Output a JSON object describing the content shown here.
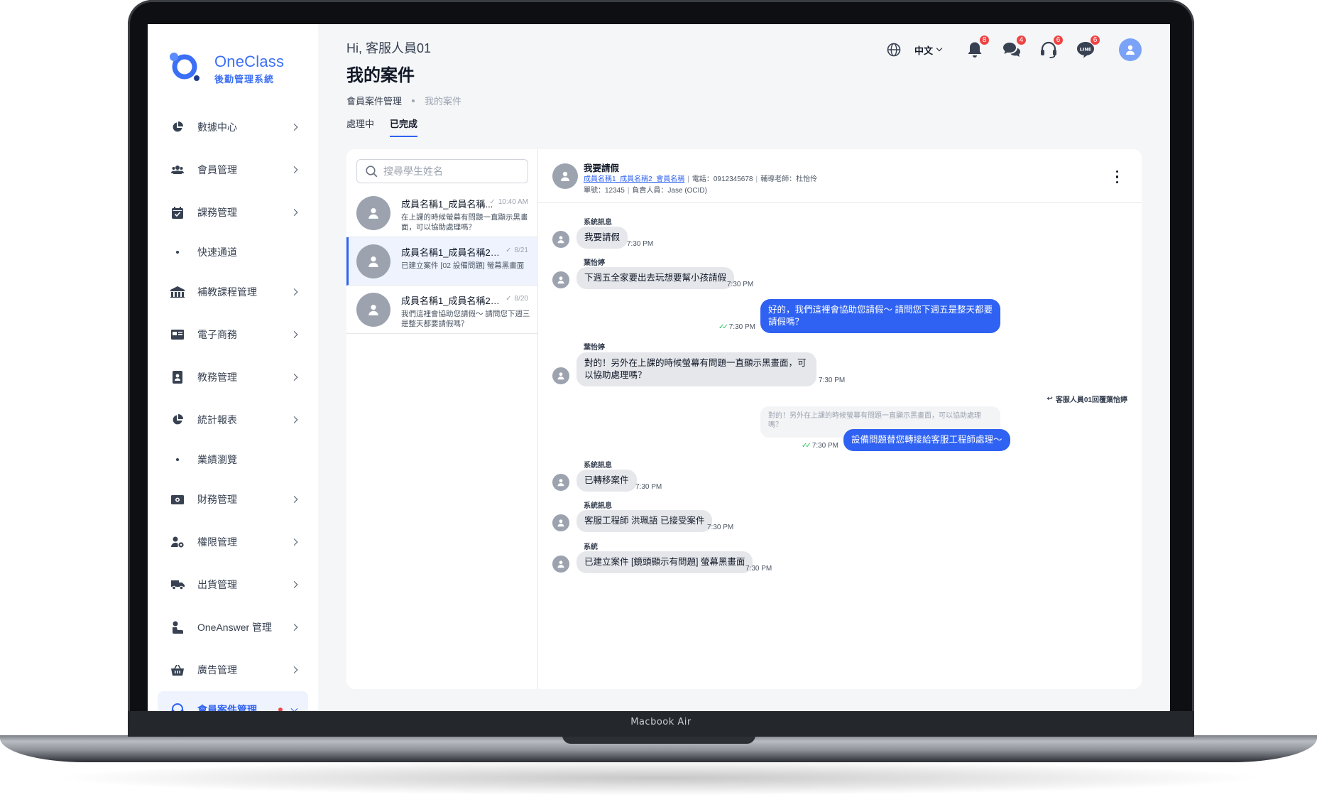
{
  "device": {
    "label": "Macbook Air"
  },
  "brand": {
    "name": "OneClass",
    "subtitle": "後勤管理系統",
    "color": "#3b6ff5"
  },
  "header": {
    "greeting": "Hi, 客服人員01",
    "title": "我的案件",
    "breadcrumb": [
      "會員案件管理",
      "我的案件"
    ],
    "tabs": [
      "處理中",
      "已完成"
    ],
    "active_tab": "已完成",
    "language": "中文",
    "badges": {
      "notifications": "8",
      "messages": "4",
      "support": "6",
      "line": "6"
    }
  },
  "sidebar": {
    "items": [
      {
        "label": "數據中心",
        "icon": "pie-chart-icon"
      },
      {
        "label": "會員管理",
        "icon": "users-icon"
      },
      {
        "label": "課務管理",
        "icon": "calendar-check-icon"
      },
      {
        "label": "快速通道",
        "icon": "dot"
      },
      {
        "label": "補教課程管理",
        "icon": "building-icon"
      },
      {
        "label": "電子商務",
        "icon": "ecommerce-icon"
      },
      {
        "label": "教務管理",
        "icon": "badge-icon"
      },
      {
        "label": "統計報表",
        "icon": "pie-chart-icon"
      },
      {
        "label": "業績瀏覽",
        "icon": "dot"
      },
      {
        "label": "財務管理",
        "icon": "money-icon"
      },
      {
        "label": "權限管理",
        "icon": "user-gear-icon"
      },
      {
        "label": "出貨管理",
        "icon": "truck-icon"
      },
      {
        "label": "OneAnswer 管理",
        "icon": "person-icon"
      },
      {
        "label": "廣告管理",
        "icon": "basket-icon"
      },
      {
        "label": "會員案件管理",
        "icon": "headset-icon"
      }
    ]
  },
  "search": {
    "placeholder": "搜尋學生姓名"
  },
  "conversations": [
    {
      "name": "成員名稱1_成員名稱...",
      "time": "10:40 AM",
      "preview": "在上課的時候螢幕有問題一直顯示黑畫面，可以協助處理嗎？"
    },
    {
      "name": "成員名稱1_成員名稱2_會...",
      "time": "8/21",
      "preview": "已建立案件 [02 設備問題] 螢幕黑畫面"
    },
    {
      "name": "成員名稱1_成員名稱2_會...",
      "time": "8/20",
      "preview": "我們這裡會協助您請假～ 請問您下週三是整天都要請假嗎？"
    }
  ],
  "chat": {
    "title": "我要請假",
    "members_link": "成員名稱1_成員名稱2_會員名稱",
    "phone": "電話：0912345678",
    "tutor": "輔導老師：杜怡伶",
    "order": "單號：12345",
    "owner": "負責人員：Jase (OCID)",
    "messages": [
      {
        "sender": "系統訊息",
        "text": "我要請假",
        "time": "7:30 PM"
      },
      {
        "sender": "葉怡婷",
        "text": "下週五全家要出去玩想要幫小孩請假",
        "time": "7:30 PM"
      },
      {
        "text": "好的，我們這裡會協助您請假～ 請問您下週五是整天都要請假嗎？",
        "time": "7:30 PM"
      },
      {
        "sender": "葉怡婷",
        "text": "對的！另外在上課的時候螢幕有問題一直顯示黑畫面，可以協助處理嗎？",
        "time": "7:30 PM"
      },
      {
        "reply_note": "客服人員01回覆葉怡婷",
        "quote": "對的！另外在上課的時候螢幕有問題一直顯示黑畫面，可以協助處理嗎？",
        "text": "設備問題替您轉接給客服工程師處理～",
        "time": "7:30 PM"
      },
      {
        "sender": "系統訊息",
        "text": "已轉移案件",
        "time": "7:30 PM"
      },
      {
        "sender": "系統訊息",
        "text": "客服工程師 洪珮語 已接受案件",
        "time": "7:30 PM"
      },
      {
        "sender": "系統",
        "text": "已建立案件 [鏡頭顯示有問題] 螢幕黑畫面",
        "time": "7:30 PM"
      }
    ]
  }
}
